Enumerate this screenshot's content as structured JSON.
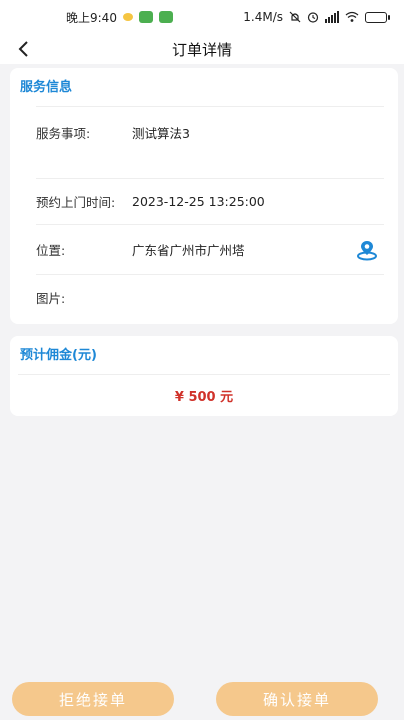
{
  "status_bar": {
    "time": "晚上9:40",
    "network_speed": "1.4M/s",
    "icons": [
      "weather-icon",
      "app-notification-icon",
      "mute-icon",
      "alarm-icon",
      "signal-icon",
      "wifi-icon",
      "battery-icon"
    ]
  },
  "header": {
    "title": "订单详情"
  },
  "service_info": {
    "section_title": "服务信息",
    "item_label": "服务事项:",
    "item_value": "测试算法3",
    "time_label": "预约上门时间:",
    "time_value": "2023-12-25 13:25:00",
    "location_label": "位置:",
    "location_value": "广东省广州市广州塔",
    "images_label": "图片:"
  },
  "commission": {
    "section_title": "预计佣金(元)",
    "amount": "¥ 500 元"
  },
  "actions": {
    "reject_label": "拒绝接单",
    "confirm_label": "确认接单"
  },
  "colors": {
    "accent_blue": "#1e88d6",
    "amount_red": "#d0322a",
    "button_orange": "#f5c88c",
    "background": "#f3f3f5"
  }
}
